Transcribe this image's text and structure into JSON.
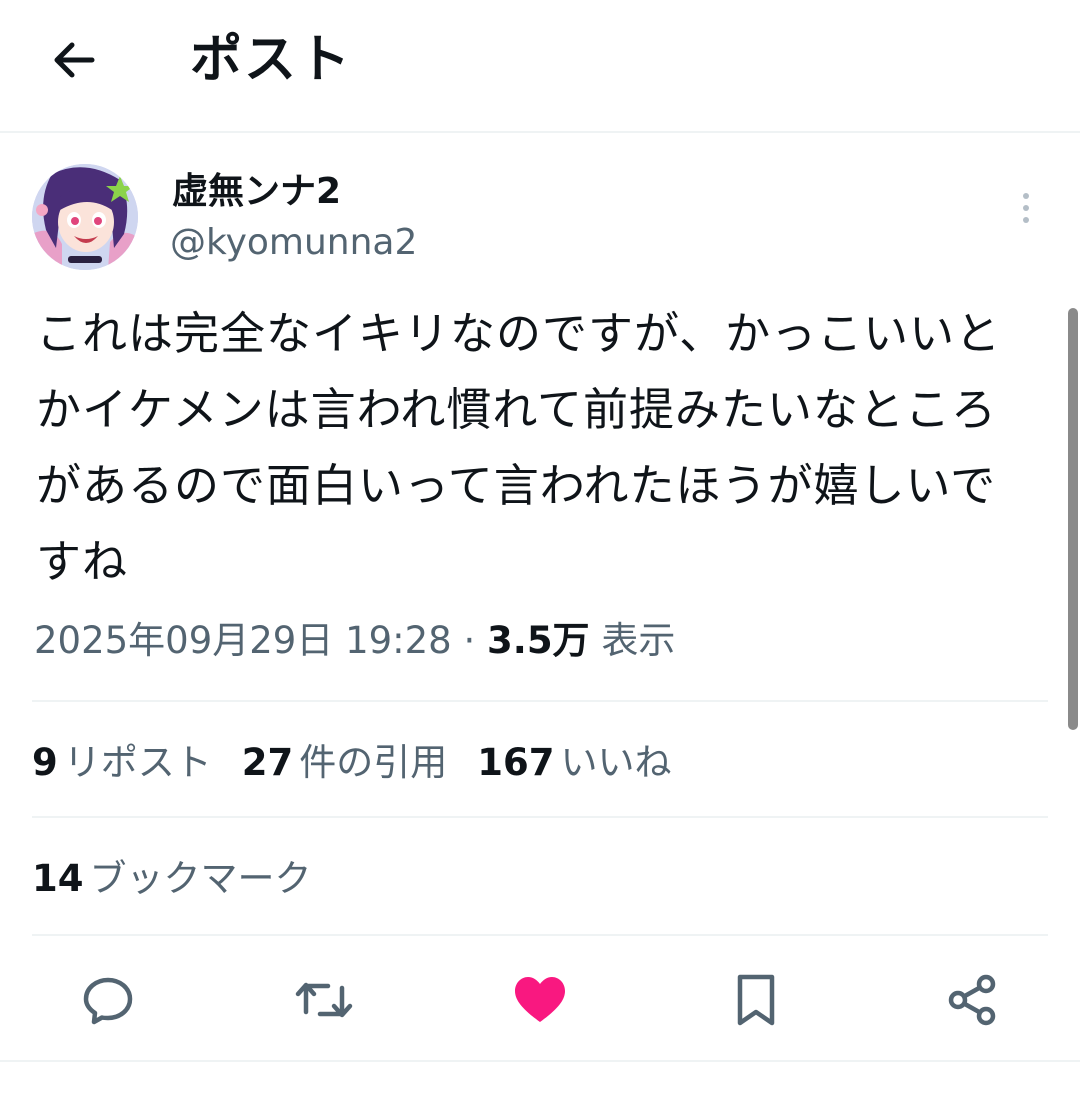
{
  "header": {
    "title": "ポスト",
    "back_icon": "arrow-left-icon"
  },
  "author": {
    "display_name": "虚無ンナ2",
    "handle": "@kyomunna2"
  },
  "post": {
    "text": "これは完全なイキリなのですが、かっこいいとかイケメンは言われ慣れて前提みたいなところがあるので面白いって言われたほうが嬉しいですね",
    "datetime": "2025年09月29日 19:28",
    "separator": " · ",
    "views_count": "3.5万",
    "views_label": " 表示"
  },
  "stats": {
    "reposts": {
      "num": "9",
      "label": "リポスト"
    },
    "quotes": {
      "num": "27",
      "label": "件の引用"
    },
    "likes": {
      "num": "167",
      "label": "いいね"
    },
    "bookmarks": {
      "num": "14",
      "label": "ブックマーク"
    }
  },
  "actions": {
    "icons": [
      "reply-icon",
      "repost-icon",
      "like-icon",
      "bookmark-icon",
      "share-icon"
    ],
    "like_color": "#f91880",
    "icon_color": "#536471"
  },
  "colors": {
    "text_primary": "#0f1419",
    "text_secondary": "#536471",
    "divider": "#eff3f4"
  }
}
